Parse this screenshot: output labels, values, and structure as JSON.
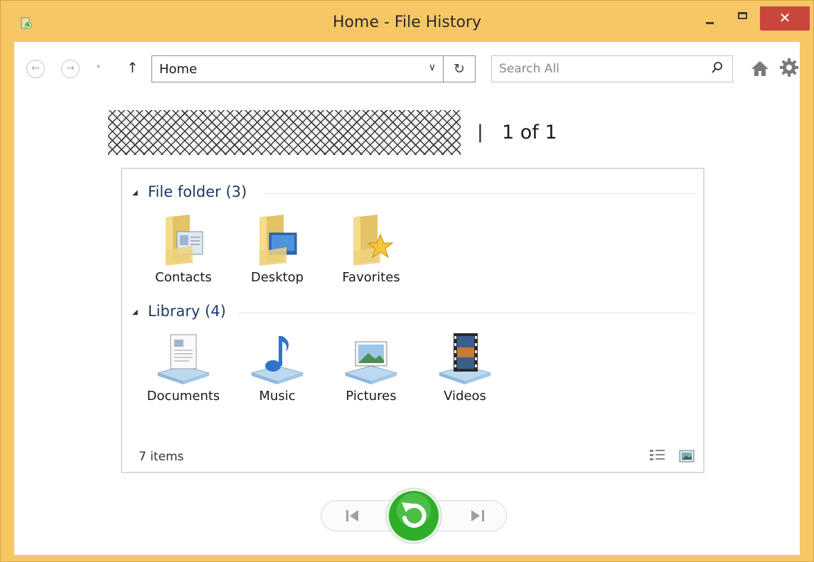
{
  "window": {
    "title": "Home - File History",
    "controls": {
      "close": "✕"
    }
  },
  "toolbar": {
    "address_value": "Home",
    "search_placeholder": "Search All"
  },
  "backup": {
    "separator": "|",
    "page_indicator": "1 of 1"
  },
  "groups": {
    "file_folder": {
      "title": "File folder (3)",
      "items": [
        {
          "label": "Contacts",
          "icon": "contacts-folder-icon"
        },
        {
          "label": "Desktop",
          "icon": "desktop-folder-icon"
        },
        {
          "label": "Favorites",
          "icon": "favorites-folder-icon"
        }
      ]
    },
    "library": {
      "title": "Library (4)",
      "items": [
        {
          "label": "Documents",
          "icon": "documents-library-icon"
        },
        {
          "label": "Music",
          "icon": "music-library-icon"
        },
        {
          "label": "Pictures",
          "icon": "pictures-library-icon"
        },
        {
          "label": "Videos",
          "icon": "videos-library-icon"
        }
      ]
    }
  },
  "status": {
    "item_count": "7 items"
  },
  "colors": {
    "frame": "#f5c865",
    "close": "#c9463d",
    "group_title": "#1e3a66",
    "restore": "#2fae2a"
  }
}
